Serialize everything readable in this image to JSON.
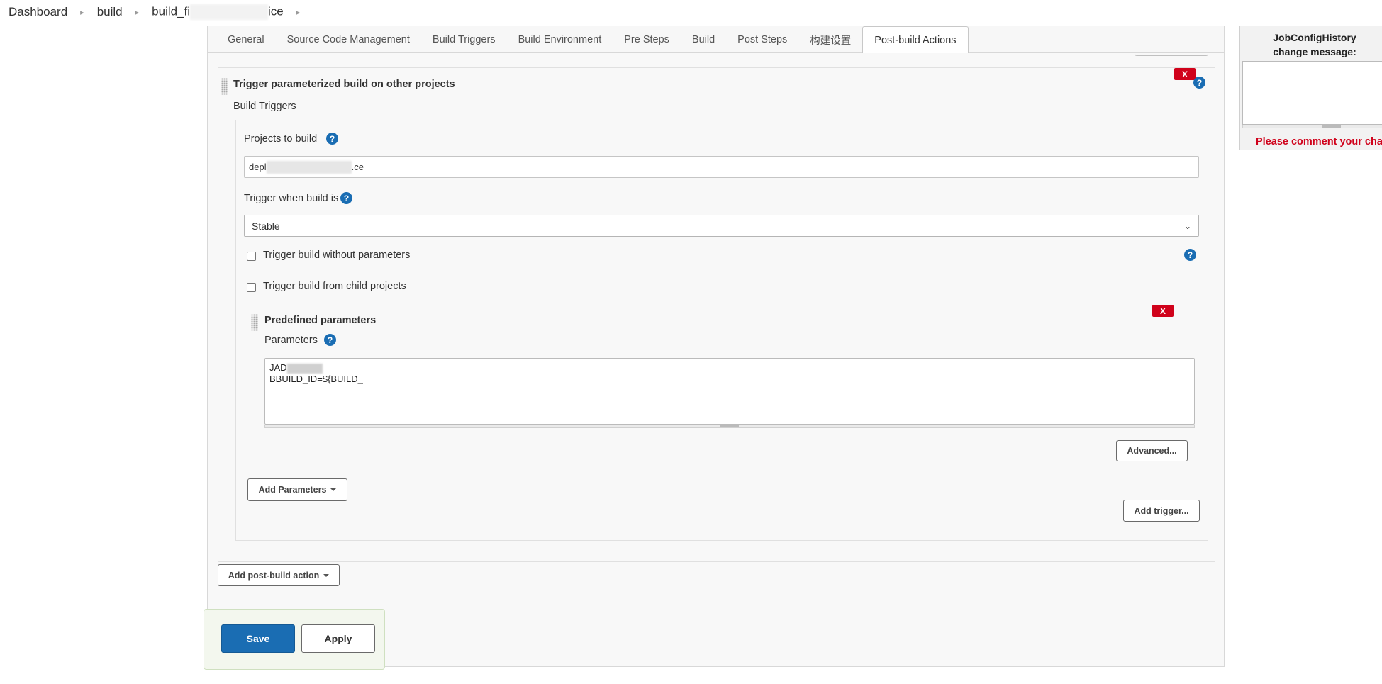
{
  "breadcrumb": {
    "items": [
      "Dashboard",
      "build",
      "build_fi",
      "ice"
    ]
  },
  "tabs": [
    {
      "label": "General"
    },
    {
      "label": "Source Code Management"
    },
    {
      "label": "Build Triggers"
    },
    {
      "label": "Build Environment"
    },
    {
      "label": "Pre Steps"
    },
    {
      "label": "Build"
    },
    {
      "label": "Post Steps"
    },
    {
      "label": "构建设置"
    },
    {
      "label": "Post-build Actions",
      "active": true
    }
  ],
  "trigger_section": {
    "title": "Trigger parameterized build on other projects",
    "remove_label": "X",
    "subheading": "Build Triggers",
    "projects_label": "Projects to build",
    "projects_value_start": "depl",
    "projects_value_end": ".ce",
    "trigger_when_label": "Trigger when build is",
    "trigger_when_value": "Stable",
    "no_params_label": "Trigger build without parameters",
    "child_projects_label": "Trigger build from child projects",
    "add_parameters_label": "Add Parameters",
    "add_trigger_label": "Add trigger..."
  },
  "predefined": {
    "title": "Predefined parameters",
    "remove_label": "X",
    "params_label": "Parameters",
    "line1": "JAD",
    "line2": "BBUILD_ID=${BUILD_",
    "advanced_label": "Advanced..."
  },
  "footer": {
    "add_post_build_label": "Add post-build action",
    "save_label": "Save",
    "apply_label": "Apply"
  },
  "history": {
    "title_line1": "JobConfigHistory",
    "title_line2": "change message:",
    "warning": "Please comment your char"
  },
  "colors": {
    "primary": "#1a6db3",
    "danger": "#d0021b"
  }
}
